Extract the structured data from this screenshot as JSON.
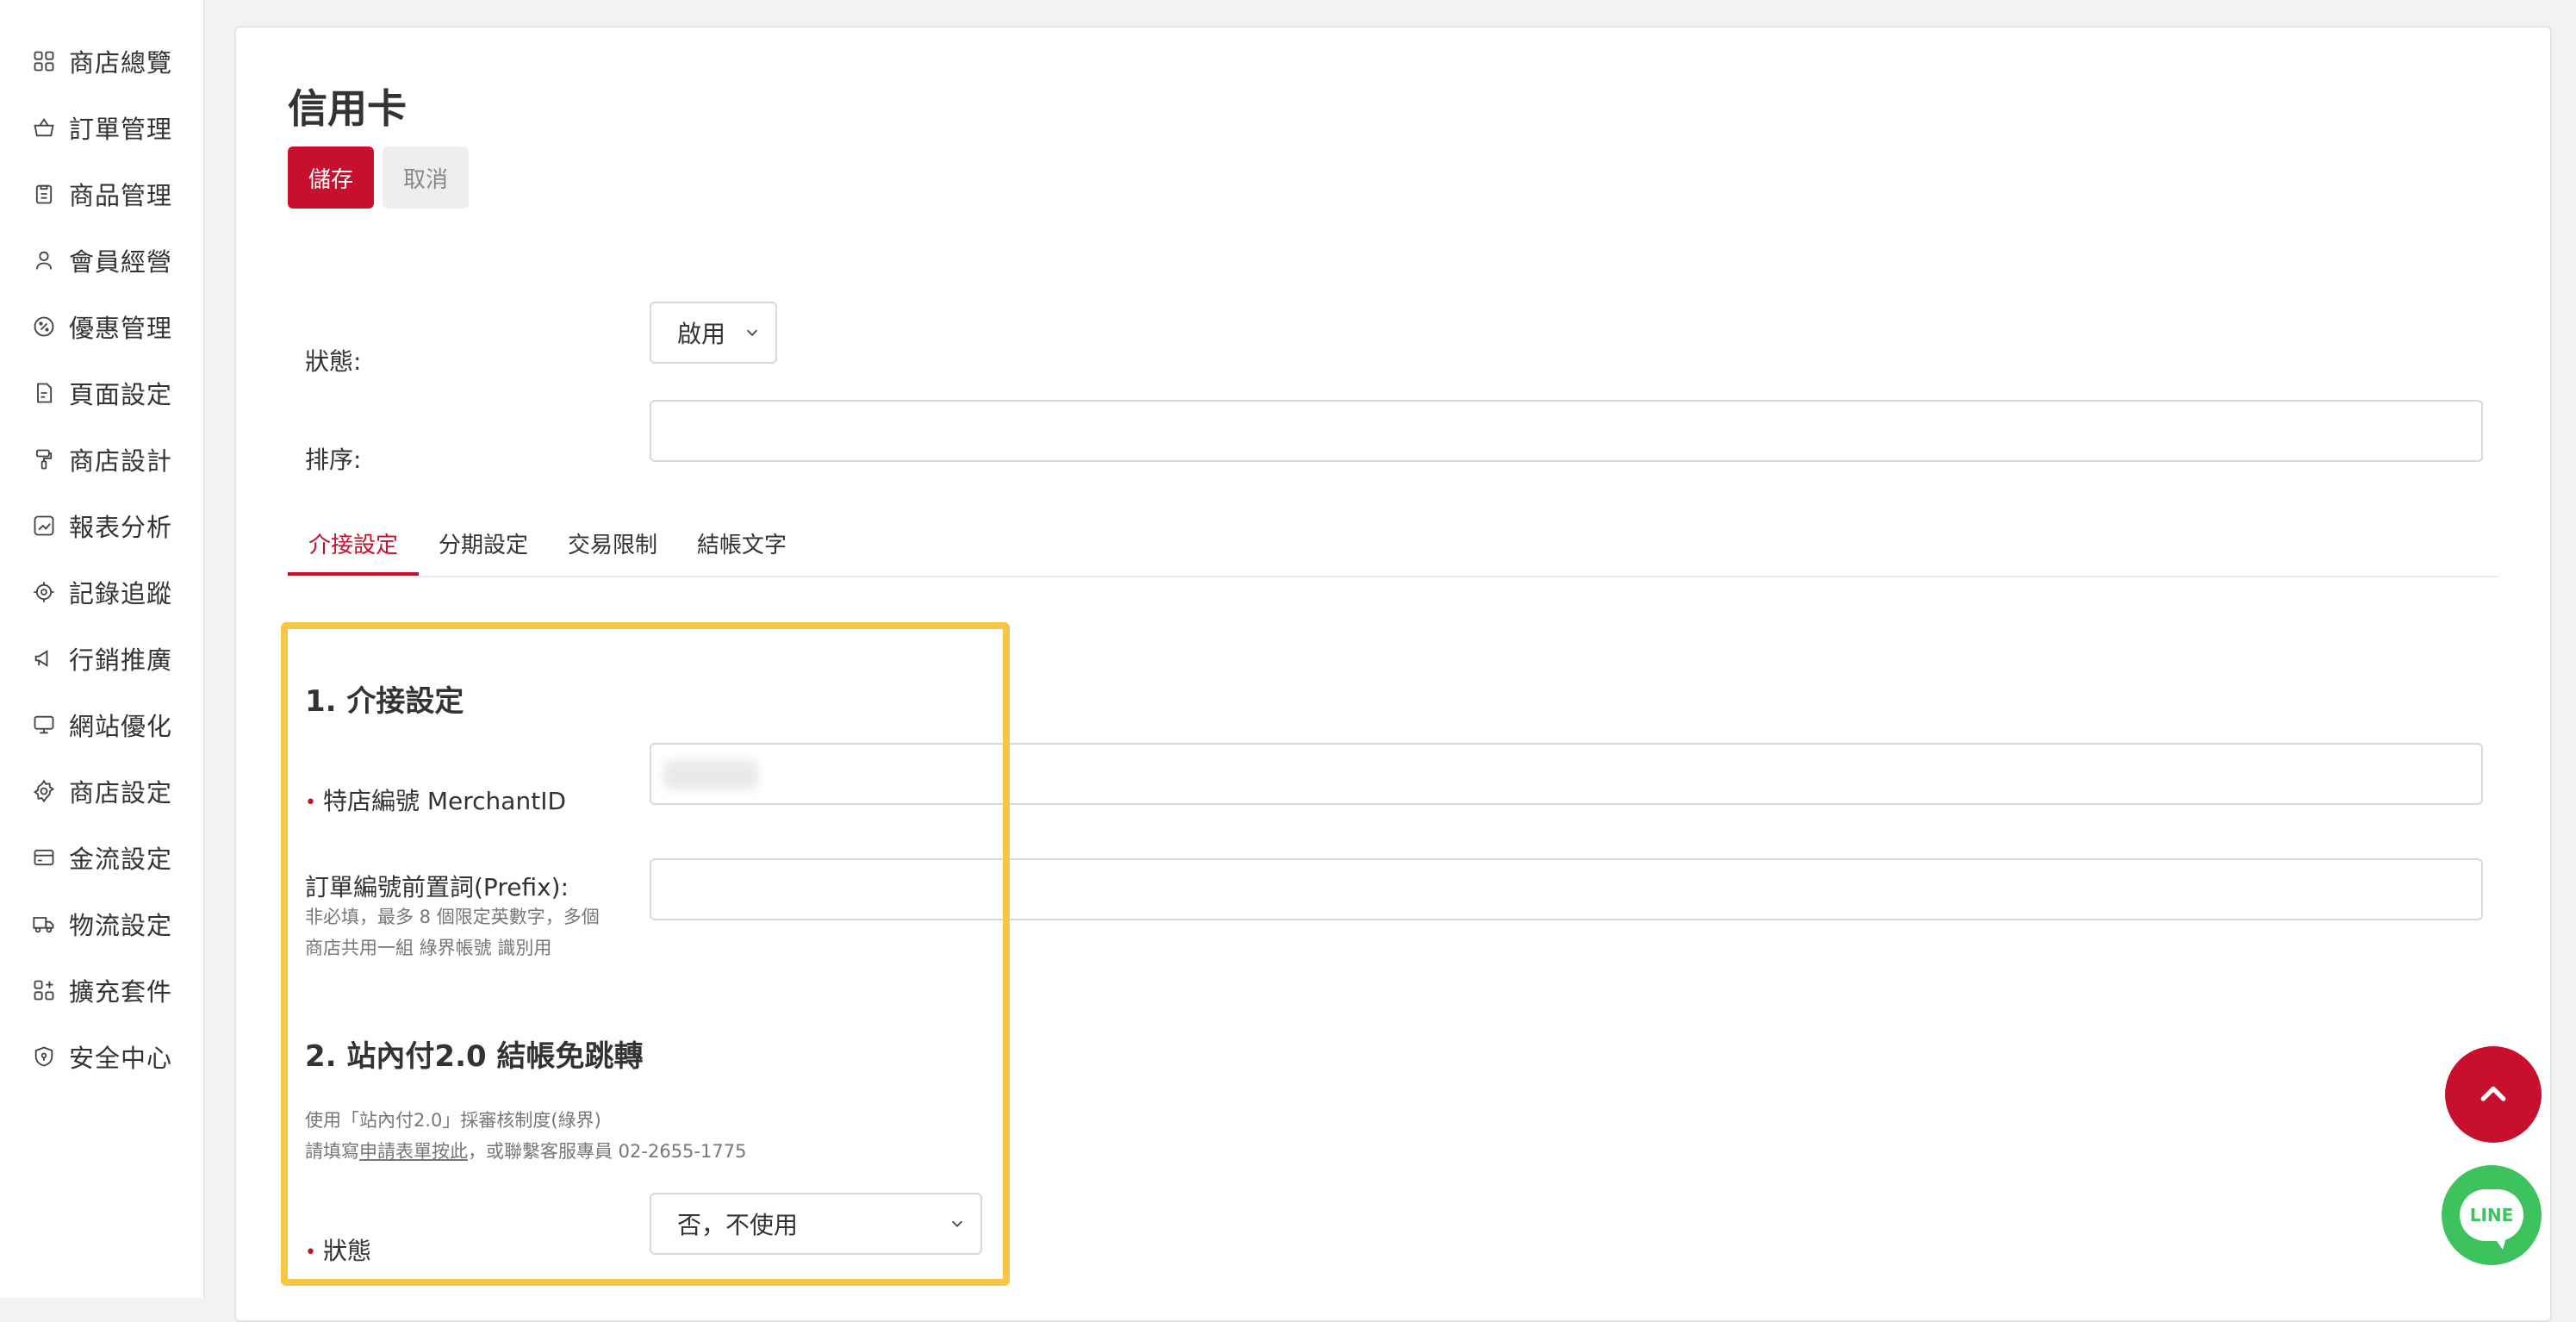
{
  "sidebar": {
    "items": [
      {
        "label": "商店總覽",
        "icon": "grid-icon"
      },
      {
        "label": "訂單管理",
        "icon": "basket-icon"
      },
      {
        "label": "商品管理",
        "icon": "clipboard-icon"
      },
      {
        "label": "會員經營",
        "icon": "user-icon"
      },
      {
        "label": "優惠管理",
        "icon": "discount-icon"
      },
      {
        "label": "頁面設定",
        "icon": "page-icon"
      },
      {
        "label": "商店設計",
        "icon": "paint-roller-icon"
      },
      {
        "label": "報表分析",
        "icon": "chart-icon"
      },
      {
        "label": "記錄追蹤",
        "icon": "target-icon"
      },
      {
        "label": "行銷推廣",
        "icon": "megaphone-icon"
      },
      {
        "label": "網站優化",
        "icon": "monitor-icon"
      },
      {
        "label": "商店設定",
        "icon": "gear-icon"
      },
      {
        "label": "金流設定",
        "icon": "card-icon"
      },
      {
        "label": "物流設定",
        "icon": "truck-icon"
      },
      {
        "label": "擴充套件",
        "icon": "apps-plus-icon"
      },
      {
        "label": "安全中心",
        "icon": "shield-icon"
      }
    ]
  },
  "page": {
    "title": "信用卡",
    "save_label": "儲存",
    "cancel_label": "取消"
  },
  "form": {
    "status_label": "狀態:",
    "status_value": "啟用",
    "order_label": "排序:",
    "order_value": ""
  },
  "tabs": [
    {
      "label": "介接設定",
      "active": true
    },
    {
      "label": "分期設定",
      "active": false
    },
    {
      "label": "交易限制",
      "active": false
    },
    {
      "label": "結帳文字",
      "active": false
    }
  ],
  "section1": {
    "title": "1. 介接設定",
    "required_mark": "•",
    "merchant_label": "特店編號 MerchantID",
    "prefix_label": "訂單編號前置詞(Prefix):",
    "prefix_hint_line1": "非必填，最多 8 個限定英數字，多個",
    "prefix_hint_line2": "商店共用一組 綠界帳號 識別用",
    "prefix_value": ""
  },
  "section2": {
    "title": "2. 站內付2.0 結帳免跳轉",
    "hint_line1": "使用「站內付2.0」採審核制度(綠界)",
    "hint_prefix": "請填寫",
    "hint_link": "申請表單按此",
    "hint_suffix": "，或聯繫客服專員 02-2655-1775",
    "status_label": "狀態",
    "status_value": "否，不使用"
  },
  "floating": {
    "line_label": "LINE"
  },
  "colors": {
    "accent": "#c8102e",
    "highlight": "#f6c744",
    "line_green": "#3ec25e"
  }
}
